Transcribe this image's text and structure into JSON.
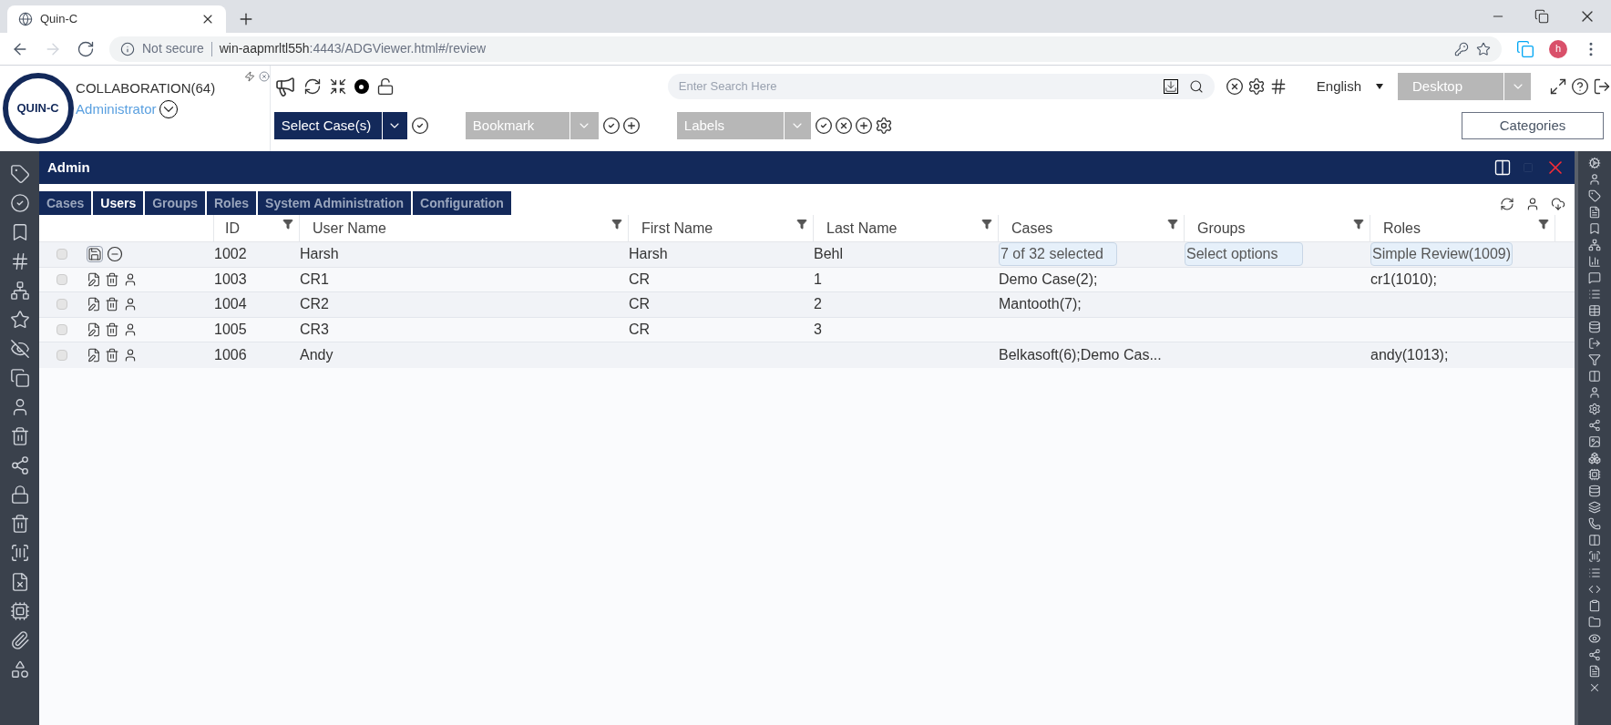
{
  "browser": {
    "tab_title": "Quin-C",
    "security": "Not secure",
    "url_host": "win-aapmrltl55h",
    "url_rest": ":4443/ADGViewer.html#/review",
    "profile_initial": "h"
  },
  "header": {
    "logo": "QUIN-C",
    "workspace": "COLLABORATION(64)",
    "role": "Administrator",
    "search_placeholder": "Enter Search Here",
    "language": "English",
    "view_mode": "Desktop",
    "select_cases": "Select Case(s)",
    "bookmark": "Bookmark",
    "labels": "Labels",
    "categories": "Categories"
  },
  "panel": {
    "title": "Admin",
    "tabs": [
      {
        "label": "Cases",
        "selected": false
      },
      {
        "label": "Users",
        "selected": true
      },
      {
        "label": "Groups",
        "selected": false
      },
      {
        "label": "Roles",
        "selected": false
      },
      {
        "label": "System Administration",
        "selected": false
      },
      {
        "label": "Configuration",
        "selected": false
      }
    ],
    "columns": [
      "ID",
      "User Name",
      "First Name",
      "Last Name",
      "Cases",
      "Groups",
      "Roles"
    ],
    "rows": [
      {
        "kind": "edit",
        "checked": false,
        "id": "1002",
        "user_name": "Harsh",
        "first_name": "Harsh",
        "last_name": "Behl",
        "cases": "7 of 32 selected",
        "groups": "Select options",
        "roles": "Simple Review(1009)"
      },
      {
        "kind": "view",
        "checked": false,
        "id": "1003",
        "user_name": "CR1",
        "first_name": "CR",
        "last_name": "1",
        "cases": "Demo Case(2);",
        "roles": "cr1(1010);"
      },
      {
        "kind": "view",
        "checked": false,
        "id": "1004",
        "user_name": "CR2",
        "first_name": "CR",
        "last_name": "2",
        "cases": "Mantooth(7);"
      },
      {
        "kind": "view",
        "checked": false,
        "id": "1005",
        "user_name": "CR3",
        "first_name": "CR",
        "last_name": "3"
      },
      {
        "kind": "view",
        "checked": false,
        "id": "1006",
        "user_name": "Andy",
        "cases": "Belkasoft(6);Demo Cas...",
        "roles": "andy(1013);"
      }
    ]
  }
}
